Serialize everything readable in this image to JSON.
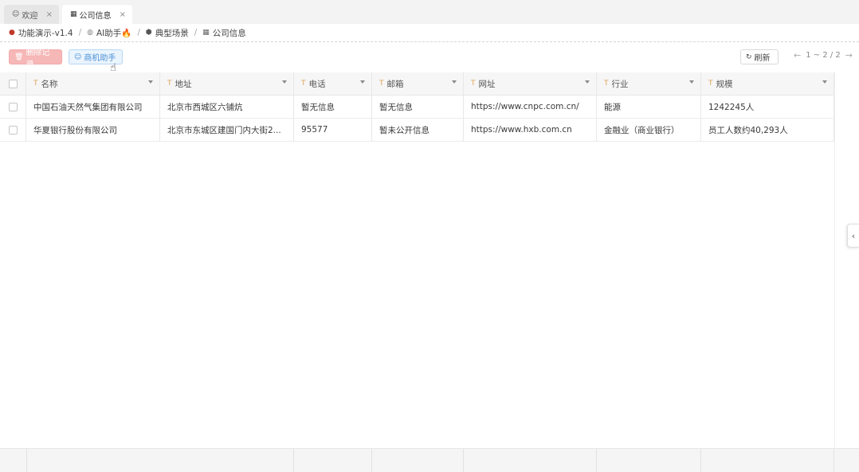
{
  "tabs": [
    {
      "label": "欢迎",
      "icon": "smile-icon",
      "close": "×"
    },
    {
      "label": "公司信息",
      "icon": "table-icon",
      "close": "×"
    }
  ],
  "breadcrumb": [
    {
      "label": "功能演示-v1.4",
      "icon": "app-logo-icon"
    },
    {
      "label": "AI助手🔥",
      "icon": "robot-icon"
    },
    {
      "label": "典型场景",
      "icon": "shield-icon"
    },
    {
      "label": "公司信息",
      "icon": "table-icon"
    }
  ],
  "toolbar": {
    "delete_label": "删除记录",
    "assistant_label": "商机助手",
    "refresh_label": "刷新",
    "pagination": "1 ~ 2 / 2"
  },
  "table": {
    "columns": [
      "名称",
      "地址",
      "电话",
      "邮箱",
      "网址",
      "行业",
      "规模"
    ],
    "rows": [
      [
        "中国石油天然气集团有限公司",
        "北京市西城区六铺炕",
        "暂无信息",
        "暂无信息",
        "https://www.cnpc.com.cn/",
        "能源",
        "1242245人"
      ],
      [
        "华夏银行股份有限公司",
        "北京市东城区建国门内大街2...",
        "95577",
        "暂未公开信息",
        "https://www.hxb.com.cn",
        "金融业（商业银行）",
        "员工人数约40,293人"
      ]
    ]
  },
  "colors": {
    "delete_bg": "#f6b7b7",
    "assistant_bg": "#eaf4fd",
    "assistant_text": "#4a90d6",
    "type_icon": "#e0a35a"
  }
}
